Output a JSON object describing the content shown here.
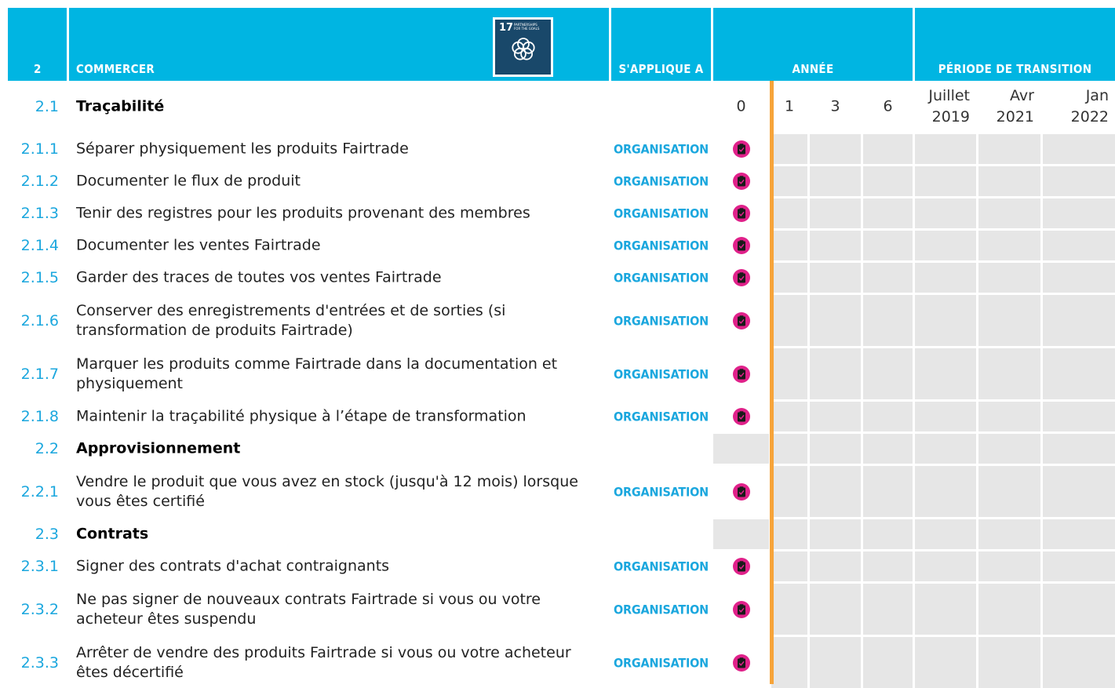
{
  "header": {
    "section_number": "2",
    "section_title": "COMMERCER",
    "sdg": {
      "number": "17",
      "label_line1": "PARTNERSHIPS",
      "label_line2": "FOR THE GOALS",
      "icon": "flower-icon",
      "color": "#19486a"
    },
    "applies_to": "S'APPLIQUE A",
    "year": "ANNÉE",
    "transition": "PÉRIODE DE TRANSITION"
  },
  "colors": {
    "header_bg": "#00b5e2",
    "accent_text": "#1ba7de",
    "badge": "#e0218a",
    "divider": "#f7a43a",
    "grid_fill": "#e6e6e6"
  },
  "year_columns": [
    "0",
    "1",
    "3",
    "6"
  ],
  "transition_columns": [
    {
      "line1": "Juillet",
      "line2": "2019"
    },
    {
      "line1": "Avr",
      "line2": "2021"
    },
    {
      "line1": "Jan",
      "line2": "2022"
    }
  ],
  "sections": [
    {
      "number": "2.1",
      "title": "Traçabilité",
      "items": [
        {
          "number": "2.1.1",
          "text": "Séparer physiquement les produits Fairtrade",
          "applies": "ORGANISATION",
          "year0_icon": "clipboard-check-icon"
        },
        {
          "number": "2.1.2",
          "text": "Documenter le flux de produit",
          "applies": "ORGANISATION",
          "year0_icon": "clipboard-check-icon"
        },
        {
          "number": "2.1.3",
          "text": "Tenir des registres pour les produits provenant des membres",
          "applies": "ORGANISATION",
          "year0_icon": "clipboard-check-icon"
        },
        {
          "number": "2.1.4",
          "text": "Documenter les ventes Fairtrade",
          "applies": "ORGANISATION",
          "year0_icon": "clipboard-check-icon"
        },
        {
          "number": "2.1.5",
          "text": "Garder des traces de toutes vos ventes Fairtrade",
          "applies": "ORGANISATION",
          "year0_icon": "clipboard-check-icon"
        },
        {
          "number": "2.1.6",
          "text": "Conserver des enregistrements d'entrées et de sorties (si transformation de produits Fairtrade)",
          "applies": "ORGANISATION",
          "year0_icon": "clipboard-check-icon"
        },
        {
          "number": "2.1.7",
          "text": "Marquer les produits comme Fairtrade dans la documentation et physiquement",
          "applies": "ORGANISATION",
          "year0_icon": "clipboard-check-icon"
        },
        {
          "number": "2.1.8",
          "text": "Maintenir la traçabilité physique à l’étape de transformation",
          "applies": "ORGANISATION",
          "year0_icon": "clipboard-check-icon"
        }
      ]
    },
    {
      "number": "2.2",
      "title": "Approvisionnement",
      "items": [
        {
          "number": "2.2.1",
          "text": "Vendre le produit que vous avez en stock (jusqu'à 12 mois) lorsque vous êtes certifié",
          "applies": "ORGANISATION",
          "year0_icon": "clipboard-check-icon"
        }
      ]
    },
    {
      "number": "2.3",
      "title": "Contrats",
      "items": [
        {
          "number": "2.3.1",
          "text": "Signer des contrats d'achat contraignants",
          "applies": "ORGANISATION",
          "year0_icon": "clipboard-check-icon"
        },
        {
          "number": "2.3.2",
          "text": "Ne pas signer de nouveaux contrats Fairtrade si vous ou votre acheteur êtes suspendu",
          "applies": "ORGANISATION",
          "year0_icon": "clipboard-check-icon"
        },
        {
          "number": "2.3.3",
          "text": "Arrêter de vendre des produits Fairtrade si vous ou votre acheteur êtes décertifié",
          "applies": "ORGANISATION",
          "year0_icon": "clipboard-check-icon"
        }
      ]
    }
  ]
}
